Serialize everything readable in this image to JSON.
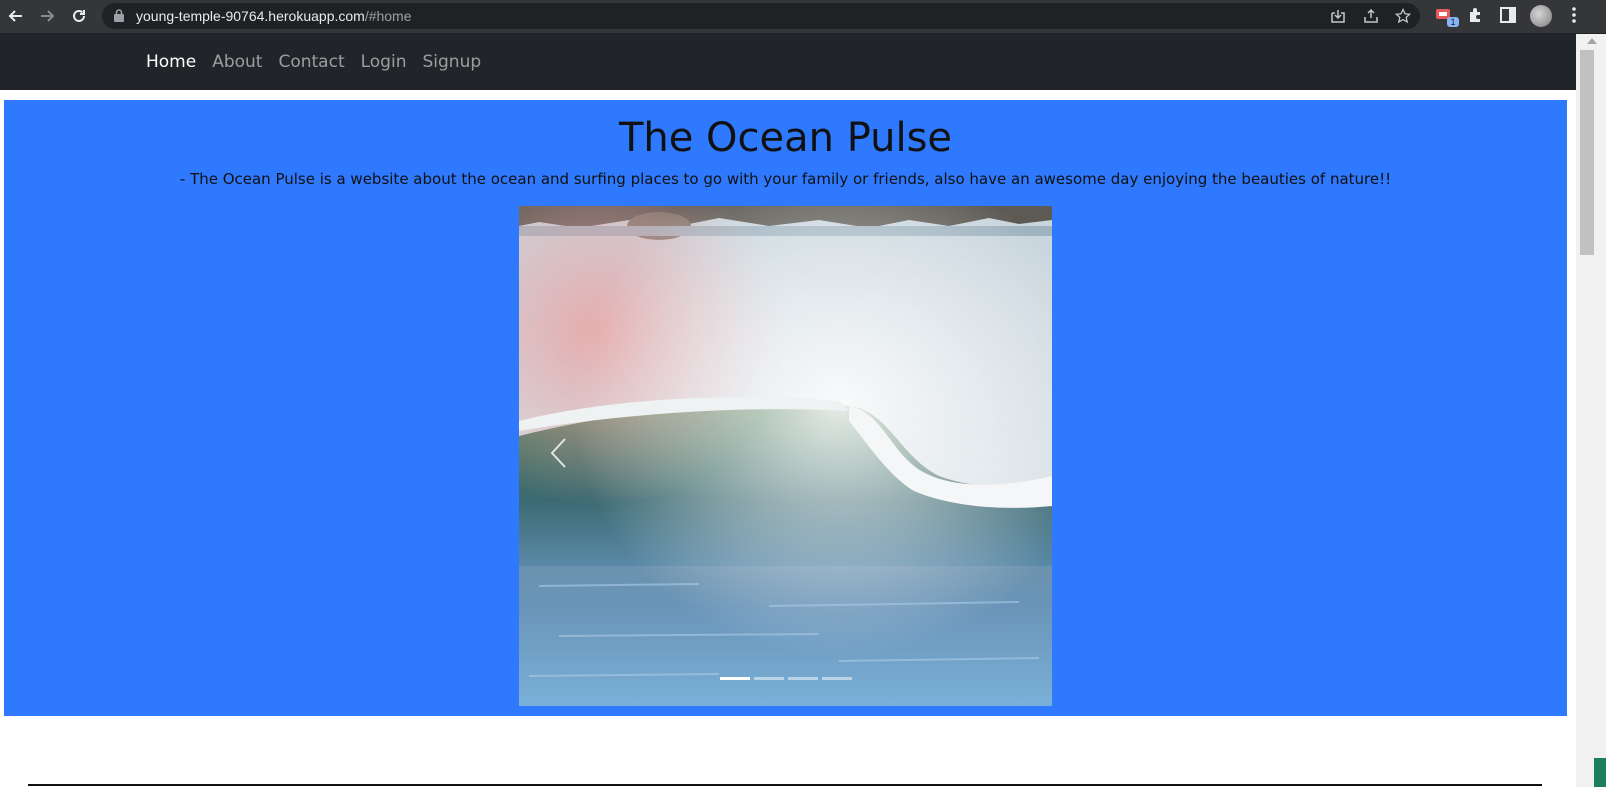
{
  "browser": {
    "url_host": "young-temple-90764.herokuapp.com",
    "url_path": "/#home",
    "extension_badge": "1"
  },
  "nav": {
    "links": [
      {
        "label": "Home"
      },
      {
        "label": "About"
      },
      {
        "label": "Contact"
      },
      {
        "label": "Login"
      },
      {
        "label": "Signup"
      }
    ],
    "active": "Home"
  },
  "hero": {
    "title": "The Ocean Pulse",
    "tagline": "- The Ocean Pulse is a website about the ocean and surfing places to go with your family or friends, also have an awesome day enjoying the beauties of nature!!",
    "background_color": "#2e79fe"
  },
  "carousel": {
    "slide_count": 4,
    "active_slide": 1,
    "image_subject": "breaking ocean wave with rainbow mist and rocks"
  },
  "colors": {
    "navbar_bg": "#212529",
    "nav_active": "#ffffff",
    "nav_inactive": "rgba(255,255,255,0.55)"
  }
}
